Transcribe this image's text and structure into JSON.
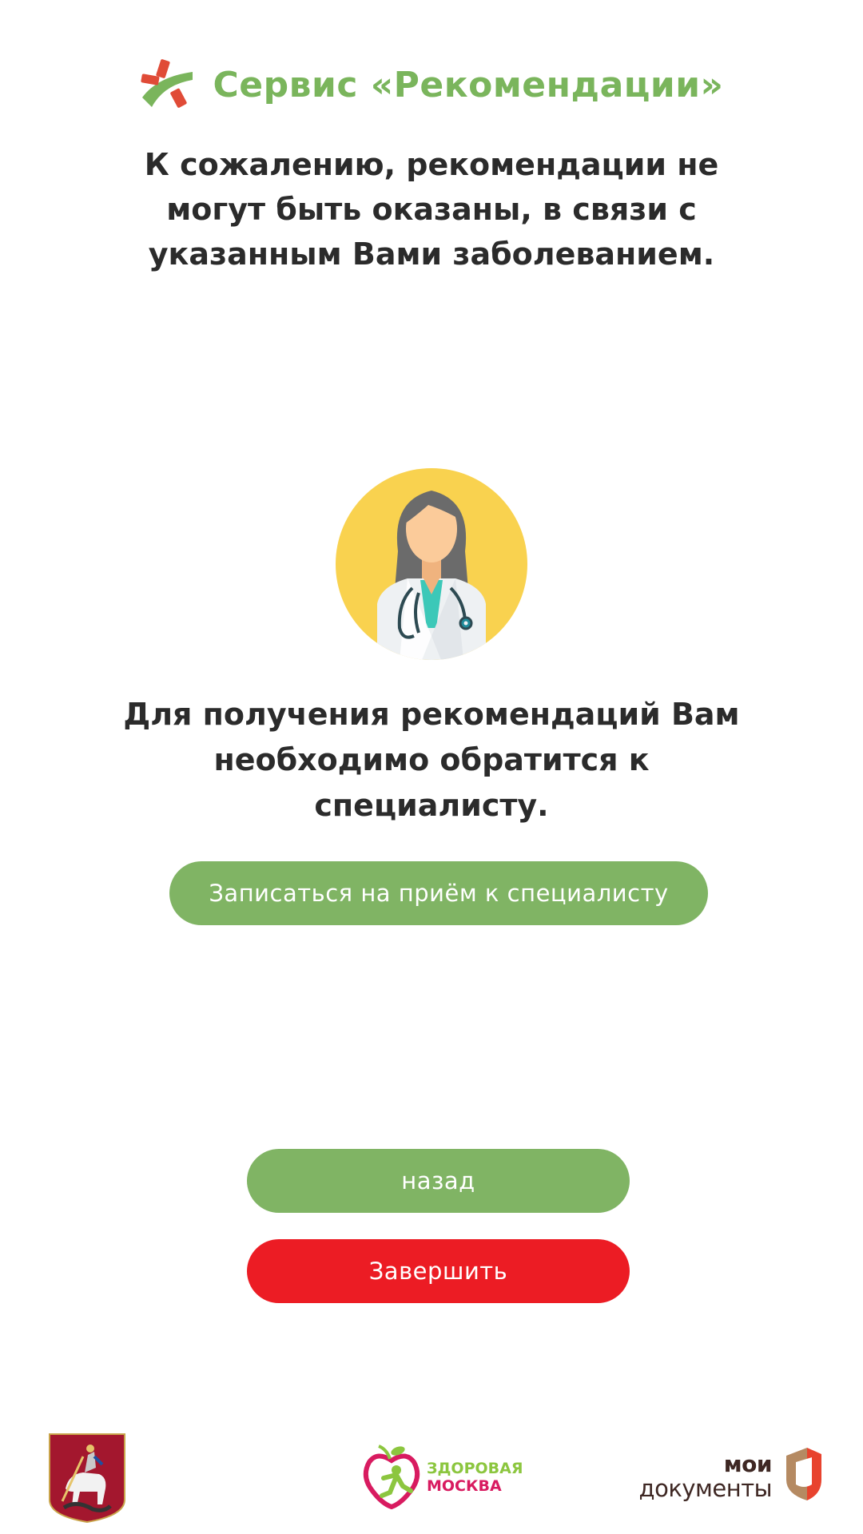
{
  "header": {
    "title": "Сервис «Рекомендации»",
    "logo_icon": "service-asterisk-icon"
  },
  "message_top": "К сожалению, рекомендации не могут быть оказаны, в связи с указанным Вами заболеванием.",
  "illustration": {
    "icon": "doctor-illustration-icon"
  },
  "message_bottom": "Для получения рекомендаций Вам необходимо обратится к специалисту.",
  "buttons": {
    "appointment_label": "Записаться на приём к специалисту",
    "back_label": "назад",
    "finish_label": "Завершить"
  },
  "footer": {
    "moscow_logo": "moscow-coat-of-arms-icon",
    "healthy_logo": {
      "line1": "ЗДОРОВАЯ",
      "line2": "МОСКВА"
    },
    "mydocs_logo": {
      "line1": "мои",
      "line2": "документы"
    }
  },
  "colors": {
    "accent_green": "#80b464",
    "title_green": "#7ab55c",
    "finish_red": "#ec1c24",
    "text_dark": "#2b2b2b"
  }
}
